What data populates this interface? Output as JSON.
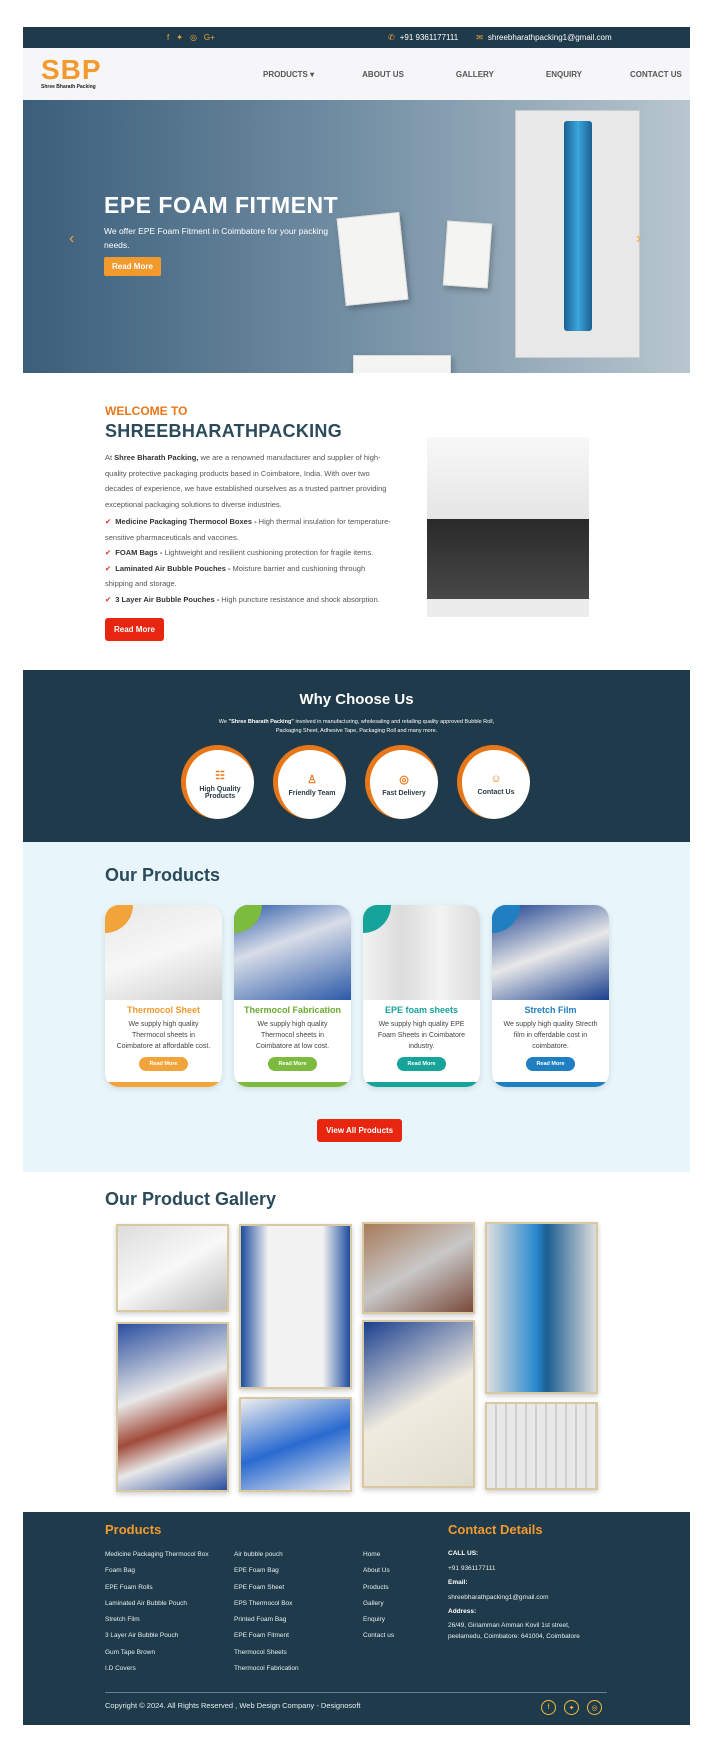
{
  "topbar": {
    "phone": "+91 9361177111",
    "email": "shreebharathpacking1@gmail.com"
  },
  "logo": {
    "text": "SBP",
    "tagline": "Shree Bharath Packing"
  },
  "nav": {
    "items": [
      "PRODUCTS ▾",
      "ABOUT US",
      "GALLERY",
      "ENQUIRY",
      "CONTACT US"
    ]
  },
  "hero": {
    "title": "EPE FOAM FITMENT",
    "desc": "We offer EPE Foam Fitment in Coimbatore for your packing needs.",
    "button": "Read More",
    "prev": "‹",
    "next": "›"
  },
  "welcome": {
    "subtitle": "WELCOME TO",
    "title": "SHREEBHARATHPACKING",
    "intro_bold": "Shree Bharath Packing,",
    "intro": " we are a renowned manufacturer and supplier of high-quality protective packaging products based in Coimbatore, India. With over two decades of experience, we have established ourselves as a trusted partner providing exceptional packaging solutions to diverse industries.",
    "points": [
      {
        "name": "Medicine Packaging Thermocol Boxes -",
        "desc": " High thermal insulation for temperature-sensitive pharmaceuticals and vaccines."
      },
      {
        "name": "FOAM Bags -",
        "desc": " Lightweight and resilient cushioning protection for fragile items."
      },
      {
        "name": "Laminated Air Bubble Pouches -",
        "desc": " Moisture barrier and cushioning through shipping and storage."
      },
      {
        "name": "3 Layer Air Bubble Pouches -",
        "desc": " High puncture resistance and shock absorption."
      }
    ],
    "button": "Read More"
  },
  "why": {
    "title": "Why Choose Us",
    "desc_pre": "We ",
    "desc_bold": "\"Shree Bharath Packing\"",
    "desc_post": " involved in manufacturing, wholesaling and retailing quality approved Bubble Roll, Packaging Sheet, Adhesive Tape, Packaging Roll and many more.",
    "items": [
      {
        "label": "High Quality Products",
        "icon": "☷"
      },
      {
        "label": "Friendly Team",
        "icon": "♙"
      },
      {
        "label": "Fast Delivery",
        "icon": "◎"
      },
      {
        "label": "Contact Us",
        "icon": "☺"
      }
    ]
  },
  "products": {
    "title": "Our Products",
    "cards": [
      {
        "name": "Thermocol Sheet",
        "desc": "We supply high quality Thermocol sheets in Coimbatore at affordable cost.",
        "button": "Read More",
        "color": "#f2a43a"
      },
      {
        "name": "Thermocol Fabrication",
        "desc": "We supply high quality Thermocol sheets in Coimbatore at low cost.",
        "button": "Read More",
        "color": "#7dbb3e"
      },
      {
        "name": "EPE foam sheets",
        "desc": "We supply high quality EPE Foam Sheets in Coimbatore industry.",
        "button": "Read More",
        "color": "#16a39a"
      },
      {
        "name": "Stretch Film",
        "desc": "We supply high quality Strecth film in offerdable cost in coimbatore.",
        "button": "Read More",
        "color": "#1f7fc0"
      }
    ],
    "view_all": "View All Products"
  },
  "gallery": {
    "title": "Our Product Gallery"
  },
  "footer": {
    "products_title": "Products",
    "col1": [
      "Medicine Packaging Thermocol Box",
      "Foam Bag",
      "EPE Foam Rolls",
      "Laminated Air Bubble Pouch",
      "Stretch Film",
      "3 Layer Air Bubble Pouch",
      "Gum Tape Brown",
      "I.D Covers"
    ],
    "col2": [
      "Air bubble pouch",
      "EPE Foam Bag",
      "EPE Foam Sheet",
      "EPS Thermocol Box",
      "Printed Foam Bag",
      "EPE Foam Fitment",
      "Thermocol Sheets",
      "Thermocol Fabrication"
    ],
    "col3": [
      "Home",
      "About Us",
      "Products",
      "Gallery",
      "Enquiry",
      "Contact us"
    ],
    "contact_title": "Contact Details",
    "call_label": "CALL US:",
    "call": "+91 9361177111",
    "email_label": "Email:",
    "email": "shreebharathpacking1@gmail.com",
    "address_label": "Address:",
    "address": "26/49, Giriamman Amman Kovil 1st street, peelamedu, Coimbatore: 641004, Coimbatore",
    "copyright": "Copyright © 2024. All Rights Reserved , Web Design Company - Designosoft"
  }
}
